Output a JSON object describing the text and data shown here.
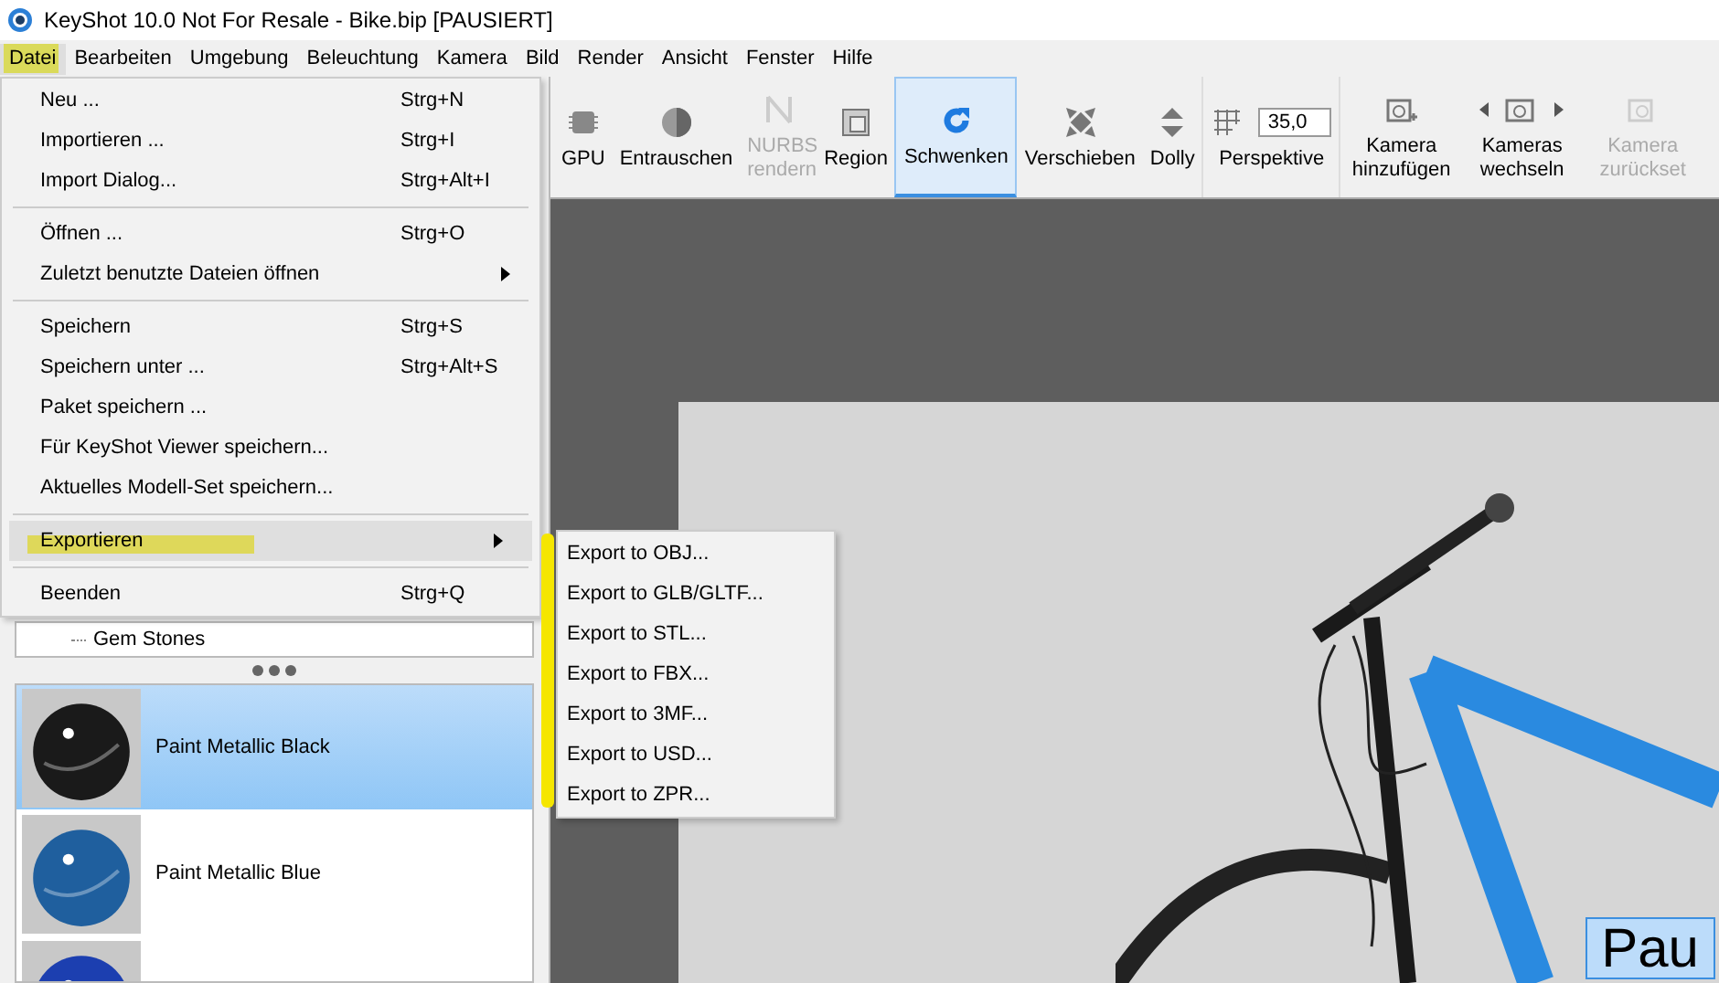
{
  "window": {
    "title": "KeyShot 10.0 Not For Resale  - Bike.bip [PAUSIERT]"
  },
  "menubar": [
    {
      "label": "Datei",
      "selected": true
    },
    {
      "label": "Bearbeiten",
      "selected": false
    },
    {
      "label": "Umgebung",
      "selected": false
    },
    {
      "label": "Beleuchtung",
      "selected": false
    },
    {
      "label": "Kamera",
      "selected": false
    },
    {
      "label": "Bild",
      "selected": false
    },
    {
      "label": "Render",
      "selected": false
    },
    {
      "label": "Ansicht",
      "selected": false
    },
    {
      "label": "Fenster",
      "selected": false
    },
    {
      "label": "Hilfe",
      "selected": false
    }
  ],
  "toolbar": [
    {
      "kind": "gpu",
      "label": "GPU",
      "disabled": false,
      "selected": false
    },
    {
      "kind": "denoise",
      "label": "Entrauschen",
      "disabled": false,
      "selected": false
    },
    {
      "kind": "nurbs",
      "label": "NURBS rendern",
      "disabled": true,
      "selected": false
    },
    {
      "kind": "region",
      "label": "Region",
      "disabled": false,
      "selected": false
    },
    {
      "kind": "tumble",
      "label": "Schwenken",
      "disabled": false,
      "selected": true
    },
    {
      "kind": "pan",
      "label": "Verschieben",
      "disabled": false,
      "selected": false
    },
    {
      "kind": "dolly",
      "label": "Dolly",
      "disabled": false,
      "selected": false
    },
    {
      "kind": "perspective",
      "label": "Perspektive",
      "value": "35,0",
      "disabled": false,
      "selected": false
    },
    {
      "kind": "addcam",
      "label": "Kamera hinzufügen",
      "disabled": false,
      "selected": false
    },
    {
      "kind": "switchcam",
      "label": "Kameras wechseln",
      "disabled": false,
      "selected": false
    },
    {
      "kind": "resetcam",
      "label": "Kamera zurückset",
      "disabled": true,
      "selected": false
    }
  ],
  "file_menu": [
    {
      "kind": "item",
      "label": "Neu ...",
      "shortcut": "Strg+N",
      "highlighted": false
    },
    {
      "kind": "item",
      "label": "Importieren ...",
      "shortcut": "Strg+I",
      "highlighted": false
    },
    {
      "kind": "item",
      "label": "Import Dialog...",
      "shortcut": "Strg+Alt+I",
      "highlighted": false
    },
    {
      "kind": "separator"
    },
    {
      "kind": "item",
      "label": "Öffnen ...",
      "shortcut": "Strg+O",
      "highlighted": false
    },
    {
      "kind": "submenu",
      "label": "Zuletzt benutzte Dateien öffnen",
      "highlighted": false
    },
    {
      "kind": "separator"
    },
    {
      "kind": "item",
      "label": "Speichern",
      "shortcut": "Strg+S",
      "highlighted": false
    },
    {
      "kind": "item",
      "label": "Speichern unter ...",
      "shortcut": "Strg+Alt+S",
      "highlighted": false
    },
    {
      "kind": "item",
      "label": "Paket speichern ...",
      "highlighted": false
    },
    {
      "kind": "item",
      "label": "Für KeyShot Viewer speichern...",
      "highlighted": false
    },
    {
      "kind": "item",
      "label": "Aktuelles Modell-Set speichern...",
      "highlighted": false
    },
    {
      "kind": "separator"
    },
    {
      "kind": "submenu",
      "label": "Exportieren",
      "highlighted": true
    },
    {
      "kind": "separator"
    },
    {
      "kind": "item",
      "label": "Beenden",
      "shortcut": "Strg+Q",
      "highlighted": false
    }
  ],
  "export_submenu": [
    {
      "label": "Export to OBJ..."
    },
    {
      "label": "Export to GLB/GLTF..."
    },
    {
      "label": "Export to STL..."
    },
    {
      "label": "Export to FBX..."
    },
    {
      "label": "Export to 3MF..."
    },
    {
      "label": "Export to USD..."
    },
    {
      "label": "Export to ZPR..."
    }
  ],
  "scene_tree": [
    {
      "label": "Gem Stones"
    }
  ],
  "materials": [
    {
      "name": "Paint Metallic Black",
      "color": "#1a1a1a",
      "selected": true
    },
    {
      "name": "Paint Metallic Blue",
      "color": "#1f5f9e",
      "selected": false
    },
    {
      "color": "#1c3fb0",
      "selected": false
    }
  ],
  "viewport": {
    "overlay_label": "Pau"
  }
}
